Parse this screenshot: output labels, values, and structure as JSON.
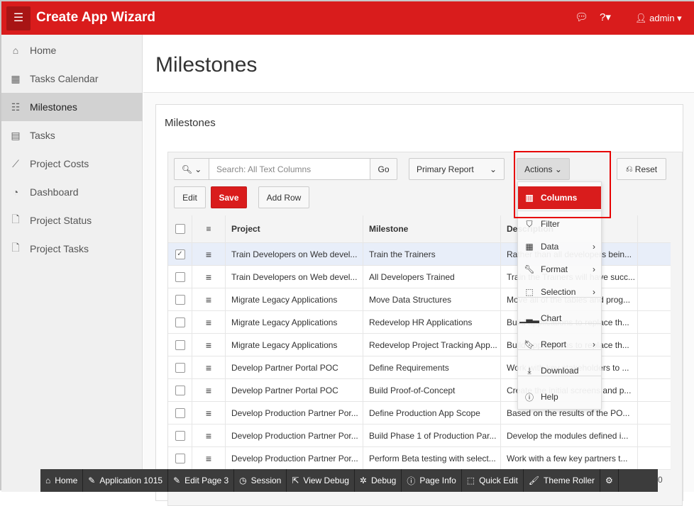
{
  "header": {
    "app_title": "Create App Wizard",
    "user": "admin"
  },
  "sidebar": {
    "items": [
      {
        "label": "Home",
        "icon": "home-icon"
      },
      {
        "label": "Tasks Calendar",
        "icon": "calendar-icon"
      },
      {
        "label": "Milestones",
        "icon": "milestones-icon",
        "active": true
      },
      {
        "label": "Tasks",
        "icon": "table-icon"
      },
      {
        "label": "Project Costs",
        "icon": "chart-line-icon"
      },
      {
        "label": "Dashboard",
        "icon": "dashboard-icon"
      },
      {
        "label": "Project Status",
        "icon": "file-icon"
      },
      {
        "label": "Project Tasks",
        "icon": "file-icon"
      }
    ]
  },
  "page": {
    "title": "Milestones",
    "region_title": "Milestones"
  },
  "toolbar": {
    "search_placeholder": "Search: All Text Columns",
    "go": "Go",
    "report": "Primary Report",
    "actions": "Actions",
    "reset": "Reset",
    "edit": "Edit",
    "save": "Save",
    "add_row": "Add Row"
  },
  "table": {
    "columns": [
      "Project",
      "Milestone",
      "Description"
    ],
    "rows": [
      [
        "Train Developers on Web devel...",
        "Train the Trainers",
        "Rather than all developers bein...",
        true
      ],
      [
        "Train Developers on Web devel...",
        "All Developers Trained",
        "Train the Trainers will have succ...",
        false
      ],
      [
        "Migrate Legacy Applications",
        "Move Data Structures",
        "Move all of the tables and prog...",
        false
      ],
      [
        "Migrate Legacy Applications",
        "Redevelop HR Applications",
        "Build applications to replace th...",
        false
      ],
      [
        "Migrate Legacy Applications",
        "Redevelop Project Tracking App...",
        "Build applications to replace th...",
        false
      ],
      [
        "Develop Partner Portal POC",
        "Define Requirements",
        "Work with key stakeholders to ...",
        false
      ],
      [
        "Develop Partner Portal POC",
        "Build Proof-of-Concept",
        "Create the initial screens and p...",
        false
      ],
      [
        "Develop Production Partner Por...",
        "Define Production App Scope",
        "Based on the results of the PO...",
        false
      ],
      [
        "Develop Production Partner Por...",
        "Build Phase 1 of Production Par...",
        "Develop the modules defined i...",
        false
      ],
      [
        "Develop Production Partner Por...",
        "Perform Beta testing with select...",
        "Work with a few key partners t...",
        false
      ]
    ]
  },
  "actions_menu": {
    "items": [
      {
        "label": "Columns",
        "icon": "columns-icon",
        "highlighted": true
      },
      {
        "label": "Filter",
        "icon": "filter-icon"
      },
      {
        "label": "Data",
        "icon": "table-icon",
        "submenu": true
      },
      {
        "label": "Format",
        "icon": "wrench-icon",
        "submenu": true
      },
      {
        "label": "Selection",
        "icon": "selection-icon",
        "submenu": true
      },
      {
        "label": "Chart",
        "icon": "chart-icon"
      },
      {
        "label": "Report",
        "icon": "bookmark-icon",
        "submenu": true
      },
      {
        "label": "Download",
        "icon": "download-icon"
      },
      {
        "label": "Help",
        "icon": "help-icon"
      }
    ]
  },
  "dev_toolbar": {
    "items": [
      "Home",
      "Application 1015",
      "Edit Page 3",
      "Session",
      "View Debug",
      "Debug",
      "Page Info",
      "Quick Edit",
      "Theme Roller"
    ],
    "trailing": "0"
  },
  "colors": {
    "brand": "#d91c1c",
    "highlight_outline": "#e60000"
  }
}
